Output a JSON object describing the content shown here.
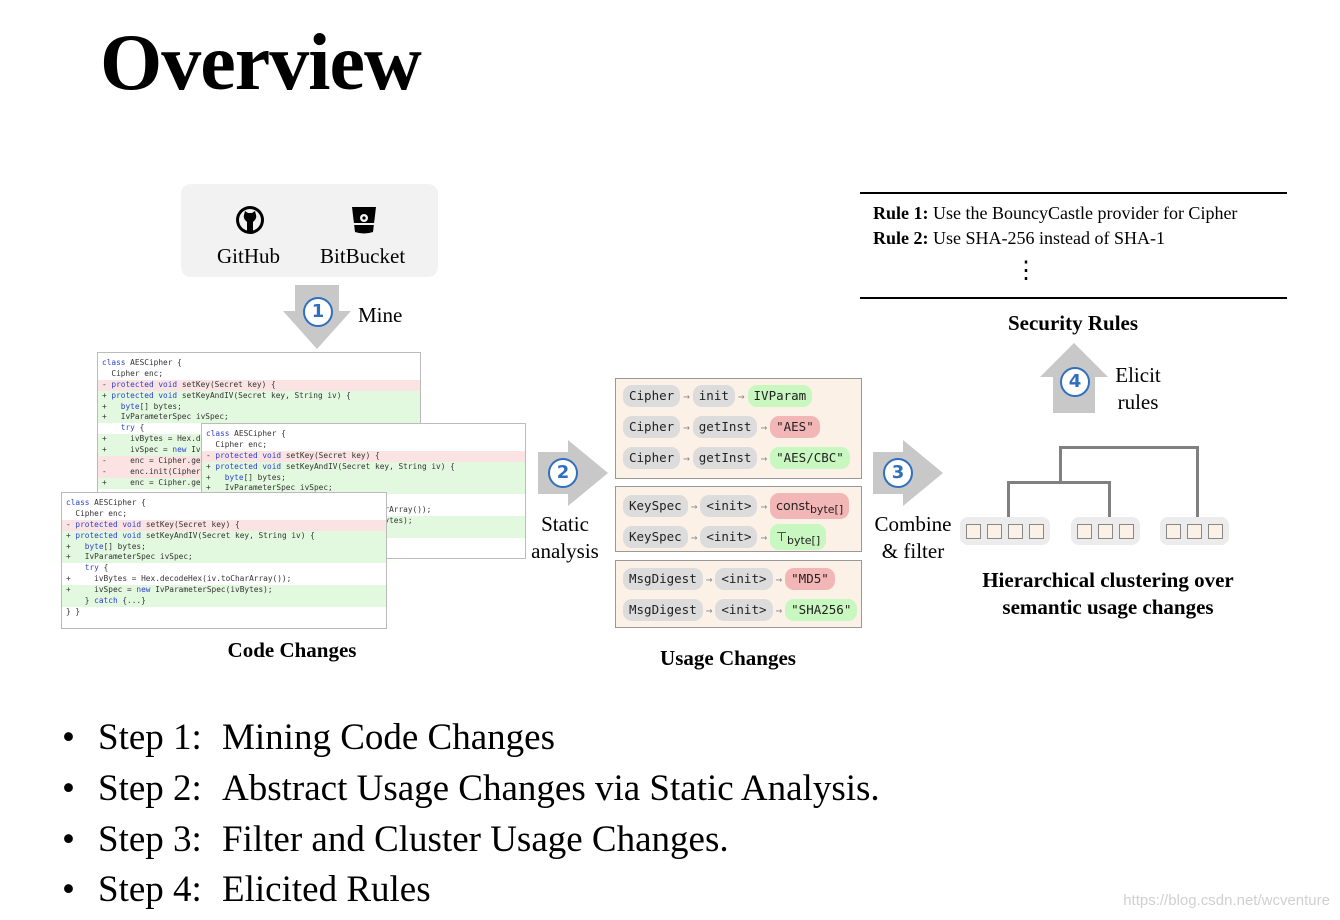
{
  "title": "Overview",
  "sources": [
    {
      "label": "GitHub",
      "icon": "github-icon"
    },
    {
      "label": "BitBucket",
      "icon": "bitbucket-icon"
    }
  ],
  "steps": {
    "s1": {
      "num": "1",
      "label": "Mine"
    },
    "s2": {
      "num": "2",
      "label_line1": "Static",
      "label_line2": "analysis"
    },
    "s3": {
      "num": "3",
      "label_line1": "Combine",
      "label_line2": "& filter"
    },
    "s4": {
      "num": "4",
      "label_line1": "Elicit",
      "label_line2": "rules"
    }
  },
  "code_changes": {
    "caption": "Code Changes",
    "back": [
      {
        "t": "class AESCipher {",
        "k": ""
      },
      {
        "t": "  Cipher enc;",
        "k": ""
      },
      {
        "t": "- protected void setKey(Secret key) {",
        "k": "del"
      },
      {
        "t": "+ protected void setKeyAndIV(Secret key, String iv) {",
        "k": "add"
      },
      {
        "t": "+   byte[] bytes;",
        "k": "add"
      },
      {
        "t": "+   IvParameterSpec ivSpec;",
        "k": "add"
      },
      {
        "t": "    try {",
        "k": ""
      },
      {
        "t": "+     ivBytes = Hex.decodeHex(iv.toCharArray());",
        "k": "add"
      },
      {
        "t": "+     ivSpec = new IvParameterSpec(ivBytes);",
        "k": "add"
      },
      {
        "t": "-     enc = Cipher.getInstance(\"AES\");",
        "k": "del"
      },
      {
        "t": "-     enc.init(Cipher.ENCRYPT_MODE, key);",
        "k": "del"
      },
      {
        "t": "+     enc = Cipher.getInstance(\"AES/CBC\");",
        "k": "add"
      }
    ],
    "middle": [
      {
        "t": "class AESCipher {",
        "k": ""
      },
      {
        "t": "  Cipher enc;",
        "k": ""
      },
      {
        "t": "- protected void setKey(Secret key) {",
        "k": "del"
      },
      {
        "t": "+ protected void setKeyAndIV(Secret key, String iv) {",
        "k": "add"
      },
      {
        "t": "+   byte[] bytes;",
        "k": "add"
      },
      {
        "t": "+   IvParameterSpec ivSpec;",
        "k": "add"
      },
      {
        "t": "    try {",
        "k": ""
      },
      {
        "t": "+     ivBytes = Hex.decodeHex(iv.toCharArray());",
        "k": ""
      },
      {
        "t": "+     ivSpec = new IvParameterSpec(ivBytes);",
        "k": "add"
      },
      {
        "t": "    } catch {...}",
        "k": "add"
      }
    ],
    "front": [
      {
        "t": "class AESCipher {",
        "k": ""
      },
      {
        "t": "  Cipher enc;",
        "k": ""
      },
      {
        "t": "- protected void setKey(Secret key) {",
        "k": "del"
      },
      {
        "t": "+ protected void setKeyAndIV(Secret key, String iv) {",
        "k": "add"
      },
      {
        "t": "+   byte[] bytes;",
        "k": "add"
      },
      {
        "t": "+   IvParameterSpec ivSpec;",
        "k": "add"
      },
      {
        "t": "    try {",
        "k": ""
      },
      {
        "t": "+     ivBytes = Hex.decodeHex(iv.toCharArray());",
        "k": ""
      },
      {
        "t": "+     ivSpec = new IvParameterSpec(ivBytes);",
        "k": "add"
      },
      {
        "t": "    } catch {...}",
        "k": "add"
      },
      {
        "t": "} }",
        "k": ""
      }
    ]
  },
  "usage_changes": {
    "caption": "Usage Changes",
    "groups": [
      [
        [
          "Cipher",
          "init",
          "IVParam",
          "g"
        ],
        [
          "Cipher",
          "getInst",
          "\"AES\"",
          "r"
        ],
        [
          "Cipher",
          "getInst",
          "\"AES/CBC\"",
          "g"
        ]
      ],
      [
        [
          "KeySpec",
          "<init>",
          "const",
          "r",
          "byte[]"
        ],
        [
          "KeySpec",
          "<init>",
          "⊤",
          "g",
          "byte[]"
        ]
      ],
      [
        [
          "MsgDigest",
          "<init>",
          "\"MD5\"",
          "r"
        ],
        [
          "MsgDigest",
          "<init>",
          "\"SHA256\"",
          "g"
        ]
      ]
    ]
  },
  "clustering": {
    "caption_line1": "Hierarchical clustering over",
    "caption_line2": "semantic usage changes",
    "leaf_counts": [
      4,
      3,
      3
    ]
  },
  "security_rules": {
    "caption": "Security Rules",
    "rules": [
      {
        "label": "Rule 1:",
        "text": " Use the BouncyCastle provider for Cipher"
      },
      {
        "label": "Rule 2:",
        "text": " Use SHA-256 instead of SHA-1"
      }
    ],
    "ellipsis": "⋮"
  },
  "bullets": [
    {
      "step": "Step 1:",
      "text": "Mining Code Changes"
    },
    {
      "step": "Step 2:",
      "text": "Abstract Usage Changes via Static Analysis."
    },
    {
      "step": "Step 3:",
      "text": "Filter and Cluster Usage Changes."
    },
    {
      "step": "Step 4:",
      "text": "Elicited Rules"
    }
  ],
  "bullet_char": "•",
  "watermark": "https://blog.csdn.net/wcventure",
  "colors": {
    "step_circle": "#2f6fbf",
    "added": "#e3f9df",
    "removed": "#fbe3e3",
    "good_pill": "#c8f7c0",
    "bad_pill": "#f3b6b6",
    "usage_box": "#fcf1e6"
  }
}
